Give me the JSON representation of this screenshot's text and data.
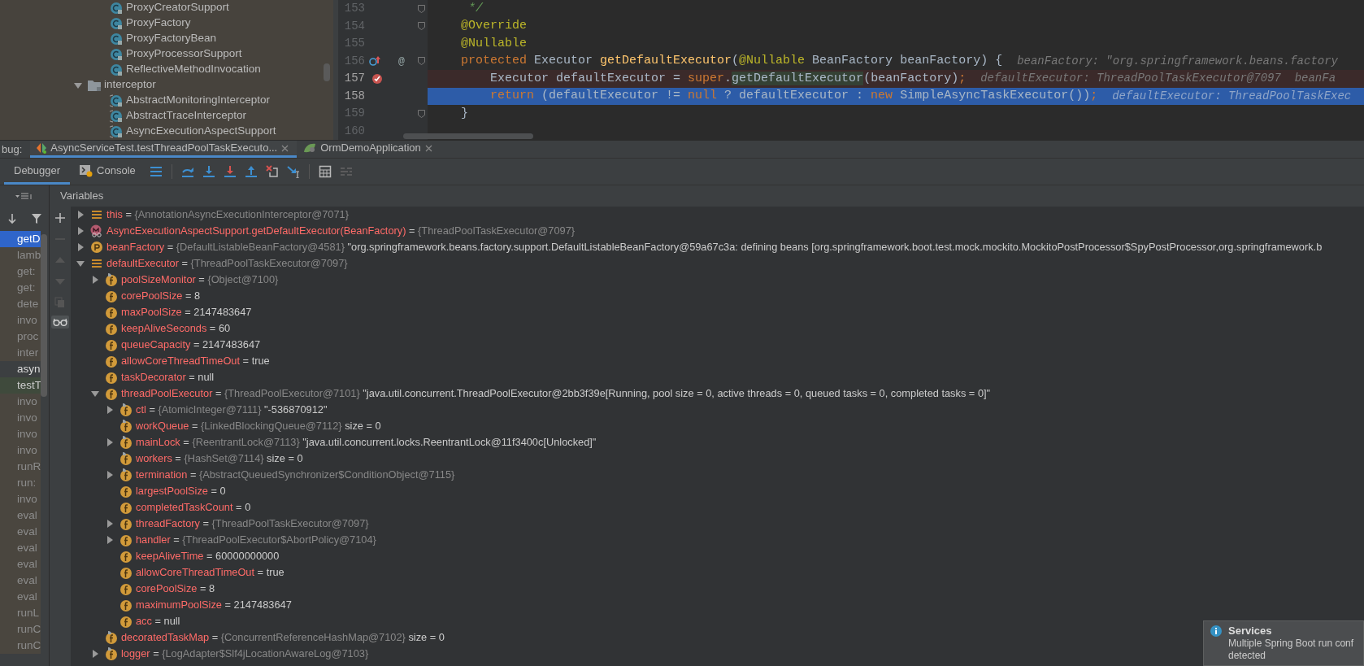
{
  "project_tree": {
    "items": [
      {
        "kind": "group",
        "children": [
          {
            "kind": "class",
            "label": "ProxyCreatorSupport"
          },
          {
            "kind": "class",
            "label": "ProxyFactory"
          },
          {
            "kind": "class",
            "label": "ProxyFactoryBean"
          },
          {
            "kind": "class",
            "label": "ProxyProcessorSupport"
          },
          {
            "kind": "class",
            "label": "ReflectiveMethodInvocation"
          }
        ]
      },
      {
        "kind": "folder",
        "label": "interceptor",
        "expanded": true,
        "children": [
          {
            "kind": "abstract-class",
            "label": "AbstractMonitoringInterceptor"
          },
          {
            "kind": "abstract-class",
            "label": "AbstractTraceInterceptor"
          },
          {
            "kind": "abstract-class",
            "label": "AsyncExecutionAspectSupport"
          }
        ]
      }
    ]
  },
  "editor": {
    "lines": [
      {
        "number": "153",
        "fold_marker": true,
        "overrides": false,
        "breakpoint": false,
        "current": false,
        "tokens": [
          {
            "kind": "comment",
            "text": "     */"
          }
        ]
      },
      {
        "number": "154",
        "fold_marker": true,
        "overrides": false,
        "breakpoint": false,
        "current": false,
        "tokens": [
          {
            "kind": "annotation",
            "text": "    @Override"
          }
        ]
      },
      {
        "number": "155",
        "fold_marker": false,
        "overrides": false,
        "breakpoint": false,
        "current": false,
        "tokens": [
          {
            "kind": "annotation",
            "text": "    @Nullable"
          }
        ]
      },
      {
        "number": "156",
        "fold_marker": true,
        "overrides": true,
        "breakpoint": false,
        "current": false,
        "gutter_mark": "@",
        "tokens": [
          {
            "kind": "keyword",
            "text": "    protected "
          },
          {
            "kind": "plain",
            "text": "Executor "
          },
          {
            "kind": "method",
            "text": "getDefaultExecutor"
          },
          {
            "kind": "plain",
            "text": "("
          },
          {
            "kind": "annotation",
            "text": "@Nullable "
          },
          {
            "kind": "plain",
            "text": "BeanFactory beanFactory) {"
          }
        ],
        "hint": "beanFactory: \"org.springframework.beans.factory"
      },
      {
        "number": "157",
        "fold_marker": false,
        "overrides": false,
        "breakpoint": true,
        "current": false,
        "tokens": [
          {
            "kind": "plain",
            "text": "        Executor defaultExecutor = "
          },
          {
            "kind": "keyword",
            "text": "super"
          },
          {
            "kind": "plain",
            "text": "."
          },
          {
            "kind": "call",
            "text": "getDefaultExecutor"
          },
          {
            "kind": "plain",
            "text": "(beanFactory)"
          },
          {
            "kind": "keyword",
            "text": ";"
          }
        ],
        "hint": "defaultExecutor: ThreadPoolTaskExecutor@7097  beanFa"
      },
      {
        "number": "158",
        "fold_marker": false,
        "overrides": false,
        "breakpoint": false,
        "current": true,
        "tokens": [
          {
            "kind": "keyword",
            "text": "        return "
          },
          {
            "kind": "plain",
            "text": "(defaultExecutor != "
          },
          {
            "kind": "keyword",
            "text": "null "
          },
          {
            "kind": "plain",
            "text": "? defaultExecutor : "
          },
          {
            "kind": "keyword",
            "text": "new "
          },
          {
            "kind": "plain",
            "text": "SimpleAsyncTaskExecutor())"
          },
          {
            "kind": "keyword",
            "text": ";"
          }
        ],
        "hint": "defaultExecutor: ThreadPoolTaskExec"
      },
      {
        "number": "159",
        "fold_marker": true,
        "overrides": false,
        "breakpoint": false,
        "current": false,
        "tokens": [
          {
            "kind": "plain",
            "text": "    }"
          }
        ]
      },
      {
        "number": "160",
        "fold_marker": false,
        "overrides": false,
        "breakpoint": false,
        "current": false
      }
    ]
  },
  "debug_panel": {
    "label": "bug:",
    "tabs": [
      {
        "kind": "test",
        "label": "AsyncServiceTest.testThreadPoolTaskExecuto...",
        "selected": true
      },
      {
        "kind": "app",
        "label": "OrmDemoApplication",
        "selected": false
      }
    ],
    "view_tabs": [
      {
        "kind": "debugger",
        "label": "Debugger",
        "selected": true
      },
      {
        "kind": "console",
        "label": "Console",
        "selected": false
      }
    ],
    "frames": [
      {
        "label": "getD",
        "kind": "user",
        "selected": true
      },
      {
        "label": "lamb",
        "kind": "library",
        "selected": false
      },
      {
        "label": "get:",
        "kind": "library",
        "selected": false
      },
      {
        "label": "get:",
        "kind": "library",
        "selected": false
      },
      {
        "label": "dete",
        "kind": "library",
        "selected": false
      },
      {
        "label": "invo",
        "kind": "library",
        "selected": false
      },
      {
        "label": "proc",
        "kind": "library",
        "selected": false
      },
      {
        "label": "inter",
        "kind": "library",
        "selected": false
      },
      {
        "label": "asyn",
        "kind": "user",
        "selected": false
      },
      {
        "label": "testT",
        "kind": "test",
        "selected": false
      },
      {
        "label": "invo",
        "kind": "library",
        "selected": false
      },
      {
        "label": "invo",
        "kind": "library",
        "selected": false
      },
      {
        "label": "invo",
        "kind": "library",
        "selected": false
      },
      {
        "label": "invo",
        "kind": "library",
        "selected": false
      },
      {
        "label": "runR",
        "kind": "library",
        "selected": false
      },
      {
        "label": "run:",
        "kind": "library",
        "selected": false
      },
      {
        "label": "invo",
        "kind": "library",
        "selected": false
      },
      {
        "label": "eval",
        "kind": "library",
        "selected": false
      },
      {
        "label": "eval",
        "kind": "library",
        "selected": false
      },
      {
        "label": "eval",
        "kind": "library",
        "selected": false
      },
      {
        "label": "eval",
        "kind": "library",
        "selected": false
      },
      {
        "label": "eval",
        "kind": "library",
        "selected": false
      },
      {
        "label": "eval",
        "kind": "library",
        "selected": false
      },
      {
        "label": "runL",
        "kind": "library",
        "selected": false
      },
      {
        "label": "runC",
        "kind": "library",
        "selected": false
      },
      {
        "label": "runC",
        "kind": "library",
        "selected": false
      }
    ],
    "variables_title": "Variables",
    "variables": [
      {
        "kind": "local",
        "name": "this",
        "op": "=",
        "type": "{AnnotationAsyncExecutionInterceptor@7071}",
        "expanded": false
      },
      {
        "kind": "return",
        "name": "AsyncExecutionAspectSupport.getDefaultExecutor(BeanFactory)",
        "op": "=",
        "type": "{ThreadPoolTaskExecutor@7097}",
        "expanded": false
      },
      {
        "kind": "param",
        "name": "beanFactory",
        "op": "=",
        "type": "{DefaultListableBeanFactory@4581}",
        "value": "\"org.springframework.beans.factory.support.DefaultListableBeanFactory@59a67c3a: defining beans [org.springframework.boot.test.mock.mockito.MockitoPostProcessor$SpyPostProcessor,org.springframework.b",
        "expanded": false
      },
      {
        "kind": "local",
        "name": "defaultExecutor",
        "op": "=",
        "type": "{ThreadPoolTaskExecutor@7097}",
        "expanded": true,
        "children": [
          {
            "kind": "field",
            "final": true,
            "name": "poolSizeMonitor",
            "op": "=",
            "type": "{Object@7100}",
            "expanded": false
          },
          {
            "kind": "field",
            "final": false,
            "name": "corePoolSize",
            "op": "=",
            "value": "8"
          },
          {
            "kind": "field",
            "final": false,
            "name": "maxPoolSize",
            "op": "=",
            "value": "2147483647"
          },
          {
            "kind": "field",
            "final": false,
            "name": "keepAliveSeconds",
            "op": "=",
            "value": "60"
          },
          {
            "kind": "field",
            "final": false,
            "name": "queueCapacity",
            "op": "=",
            "value": "2147483647"
          },
          {
            "kind": "field",
            "final": false,
            "name": "allowCoreThreadTimeOut",
            "op": "=",
            "value": "true"
          },
          {
            "kind": "field",
            "final": false,
            "name": "taskDecorator",
            "op": "=",
            "value": "null"
          },
          {
            "kind": "field",
            "final": false,
            "name": "threadPoolExecutor",
            "op": "=",
            "type": "{ThreadPoolExecutor@7101}",
            "value": "\"java.util.concurrent.ThreadPoolExecutor@2bb3f39e[Running, pool size = 0, active threads = 0, queued tasks = 0, completed tasks = 0]\"",
            "expanded": true,
            "children": [
              {
                "kind": "field",
                "final": true,
                "name": "ctl",
                "op": "=",
                "type": "{AtomicInteger@7111}",
                "value": "\"-536870912\"",
                "expanded": false
              },
              {
                "kind": "field",
                "final": true,
                "name": "workQueue",
                "op": "=",
                "type": "{LinkedBlockingQueue@7112}",
                "value": "size = 0"
              },
              {
                "kind": "field",
                "final": true,
                "name": "mainLock",
                "op": "=",
                "type": "{ReentrantLock@7113}",
                "value": "\"java.util.concurrent.locks.ReentrantLock@11f3400c[Unlocked]\"",
                "expanded": false
              },
              {
                "kind": "field",
                "final": true,
                "name": "workers",
                "op": "=",
                "type": "{HashSet@7114}",
                "value": "size = 0"
              },
              {
                "kind": "field",
                "final": true,
                "name": "termination",
                "op": "=",
                "type": "{AbstractQueuedSynchronizer$ConditionObject@7115}",
                "expanded": false
              },
              {
                "kind": "field",
                "final": false,
                "name": "largestPoolSize",
                "op": "=",
                "value": "0"
              },
              {
                "kind": "field",
                "final": false,
                "name": "completedTaskCount",
                "op": "=",
                "value": "0"
              },
              {
                "kind": "field",
                "final": false,
                "name": "threadFactory",
                "op": "=",
                "type": "{ThreadPoolTaskExecutor@7097}",
                "expanded": false
              },
              {
                "kind": "field",
                "final": false,
                "name": "handler",
                "op": "=",
                "type": "{ThreadPoolExecutor$AbortPolicy@7104}",
                "expanded": false
              },
              {
                "kind": "field",
                "final": false,
                "name": "keepAliveTime",
                "op": "=",
                "value": "60000000000"
              },
              {
                "kind": "field",
                "final": false,
                "name": "allowCoreThreadTimeOut",
                "op": "=",
                "value": "true"
              },
              {
                "kind": "field",
                "final": false,
                "name": "corePoolSize",
                "op": "=",
                "value": "8"
              },
              {
                "kind": "field",
                "final": false,
                "name": "maximumPoolSize",
                "op": "=",
                "value": "2147483647"
              },
              {
                "kind": "field",
                "final": false,
                "name": "acc",
                "op": "=",
                "value": "null"
              }
            ]
          },
          {
            "kind": "field",
            "final": true,
            "name": "decoratedTaskMap",
            "op": "=",
            "type": "{ConcurrentReferenceHashMap@7102}",
            "value": "size = 0"
          },
          {
            "kind": "field",
            "final": true,
            "name": "logger",
            "op": "=",
            "type": "{LogAdapter$Slf4jLocationAwareLog@7103}",
            "expanded": false
          }
        ]
      }
    ]
  },
  "notification": {
    "title": "Services",
    "lines": [
      "Multiple Spring Boot run conf",
      "detected"
    ]
  }
}
